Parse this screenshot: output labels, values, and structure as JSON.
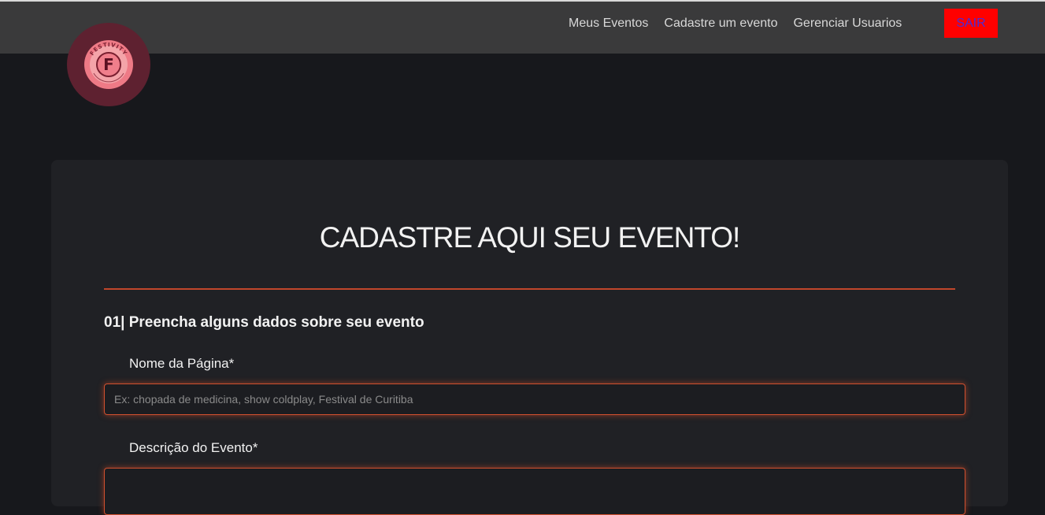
{
  "header": {
    "nav": [
      "Meus Eventos",
      "Cadastre um evento",
      "Gerenciar Usuarios"
    ],
    "logout_label": "SAIR",
    "logout_bg_color": "#ff0000",
    "logout_text_color": "#4b2bd6"
  },
  "logo": {
    "text": "FESTIVITY",
    "letter": "F"
  },
  "form": {
    "title": "CADASTRE AQUI SEU EVENTO!",
    "step_title": "01| Preencha alguns dados sobre seu evento",
    "fields": [
      {
        "label": "Nome da Página*",
        "placeholder": "Ex: chopada de medicina, show coldplay, Festival de Curitiba",
        "value": ""
      },
      {
        "label": "Descrição do Evento*",
        "placeholder": "",
        "value": ""
      }
    ],
    "accent_color": "#d0502f"
  }
}
